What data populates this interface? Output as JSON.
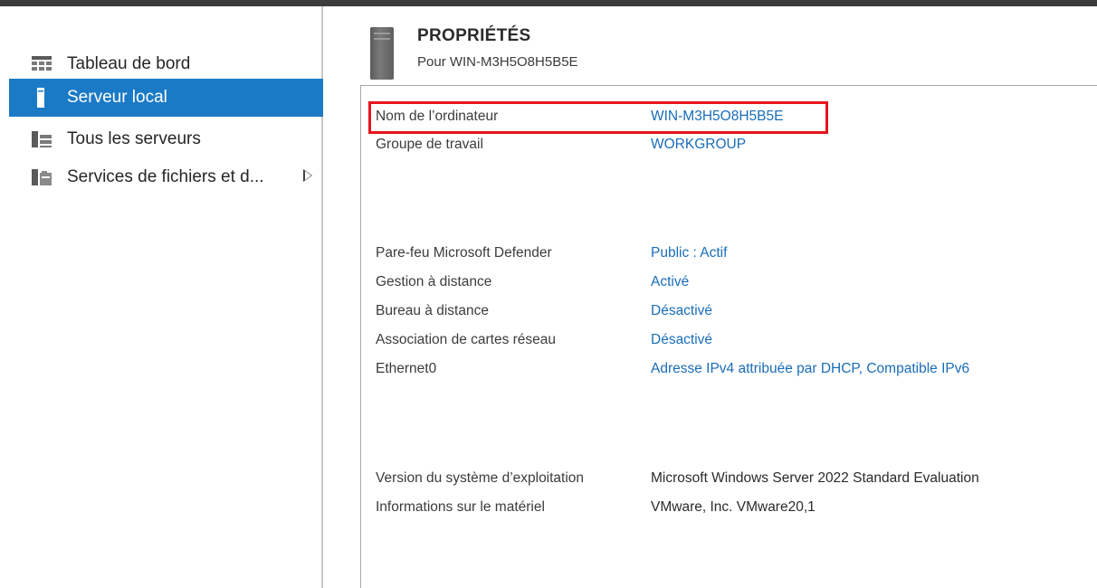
{
  "sidebar": {
    "items": [
      {
        "label": "Tableau de bord",
        "icon": "dashboard-icon",
        "selected": false
      },
      {
        "label": "Serveur local",
        "icon": "server-icon",
        "selected": true
      },
      {
        "label": "Tous les serveurs",
        "icon": "servers-icon",
        "selected": false
      },
      {
        "label": "Services de fichiers et d...",
        "icon": "file-services-icon",
        "selected": false,
        "has_submenu": true
      }
    ]
  },
  "properties": {
    "title": "PROPRIÉTÉS",
    "subtitle": "Pour WIN-M3H5O8H5B5E",
    "rows": [
      {
        "label": "Nom de l’ordinateur",
        "value": "WIN-M3H5O8H5B5E",
        "link": true,
        "highlighted": true
      },
      {
        "label": "Groupe de travail",
        "value": "WORKGROUP",
        "link": true
      },
      {
        "label": "Pare-feu Microsoft Defender",
        "value": "Public : Actif",
        "link": true
      },
      {
        "label": "Gestion à distance",
        "value": "Activé",
        "link": true
      },
      {
        "label": "Bureau à distance",
        "value": "Désactivé",
        "link": true
      },
      {
        "label": "Association de cartes réseau",
        "value": "Désactivé",
        "link": true
      },
      {
        "label": "Ethernet0",
        "value": "Adresse IPv4 attribuée par DHCP, Compatible IPv6",
        "link": true
      },
      {
        "label": "Version du système d’exploitation",
        "value": "Microsoft Windows Server 2022 Standard Evaluation",
        "link": false
      },
      {
        "label": "Informations sur le matériel",
        "value": "VMware, Inc. VMware20,1",
        "link": false
      }
    ]
  },
  "colors": {
    "selection": "#1b7ac6",
    "link": "#1a6db8",
    "highlight": "#e8141c"
  }
}
